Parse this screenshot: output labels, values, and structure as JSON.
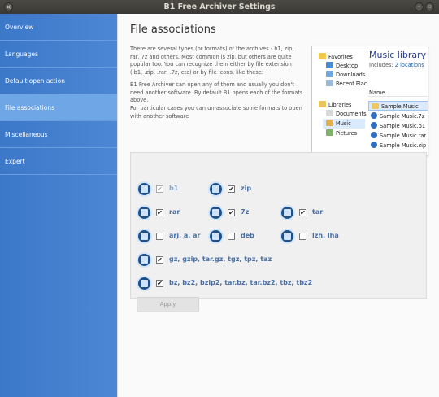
{
  "window": {
    "title": "B1 Free Archiver Settings",
    "close_glyph": "×",
    "min_glyph": "–",
    "max_glyph": "▫"
  },
  "sidebar": {
    "items": [
      {
        "label": "Overview",
        "active": false
      },
      {
        "label": "Languages",
        "active": false
      },
      {
        "label": "Default open action",
        "active": false
      },
      {
        "label": "File associations",
        "active": true
      },
      {
        "label": "Miscellaneous",
        "active": false
      },
      {
        "label": "Expert",
        "active": false
      }
    ]
  },
  "main": {
    "title": "File associations",
    "paragraphs": [
      "There are several types (or formats) of the archives - b1, zip, rar, 7z and others. Most common is zip, but others are quite popular too. You can recognize them either by file extension (.b1, .zip, .rar, .7z, etc) or by file icons, like these:",
      "B1 Free Archiver can open any of them and usually you don't need another software. By default B1 opens each of the formats above.",
      "For particular cases you can un-associate some formats to open with another software"
    ]
  },
  "preview": {
    "nav": [
      {
        "label": "Favorites",
        "icon": "star-icon"
      },
      {
        "label": "Desktop",
        "icon": "desktop-icon"
      },
      {
        "label": "Downloads",
        "icon": "downloads-icon"
      },
      {
        "label": "Recent Plac",
        "icon": "recent-places-icon"
      },
      {
        "label": "Libraries",
        "icon": "libraries-icon"
      },
      {
        "label": "Documents",
        "icon": "documents-icon"
      },
      {
        "label": "Music",
        "icon": "music-icon",
        "selected": true
      },
      {
        "label": "Pictures",
        "icon": "pictures-icon"
      }
    ],
    "library_title": "Music library",
    "includes_label": "Includes:",
    "includes_link": "2 locations",
    "column_name": "Name",
    "files": [
      {
        "name": "Sample Music",
        "type": "folder",
        "selected": true
      },
      {
        "name": "Sample Music.7z",
        "type": "archive"
      },
      {
        "name": "Sample Music.b1",
        "type": "archive"
      },
      {
        "name": "Sample Music.rar",
        "type": "archive"
      },
      {
        "name": "Sample Music.zip",
        "type": "archive"
      }
    ]
  },
  "formats": [
    {
      "label": "b1",
      "checked": true,
      "disabled": true
    },
    {
      "label": "zip",
      "checked": true,
      "disabled": false
    },
    {
      "label": "rar",
      "checked": true,
      "disabled": false
    },
    {
      "label": "7z",
      "checked": true,
      "disabled": false
    },
    {
      "label": "tar",
      "checked": true,
      "disabled": false
    },
    {
      "label": "arj, a, ar",
      "checked": false,
      "disabled": false
    },
    {
      "label": "deb",
      "checked": false,
      "disabled": false
    },
    {
      "label": "lzh, lha",
      "checked": false,
      "disabled": false
    },
    {
      "label": "gz, gzip, tar.gz, tgz, tpz, taz",
      "checked": true,
      "disabled": false
    },
    {
      "label": "bz, bz2, bzip2, tar.bz, tar.bz2, tbz, tbz2",
      "checked": true,
      "disabled": false
    }
  ],
  "check_glyph": "✔",
  "apply_label": "Apply",
  "colors": {
    "sidebar": "#3c78c8",
    "sidebar_active": "#6ea6e6",
    "format_label": "#4a6fa5",
    "library_title": "#1e3a8a"
  }
}
